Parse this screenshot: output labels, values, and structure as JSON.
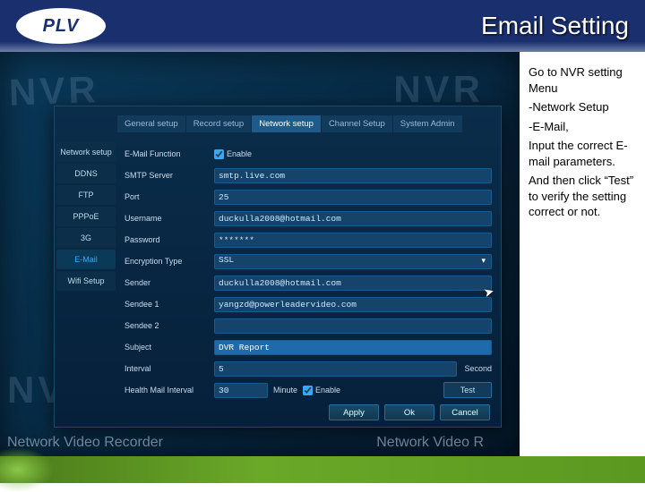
{
  "header": {
    "logo": "PLV",
    "title": "Email Setting"
  },
  "tabs": [
    {
      "label": "General setup"
    },
    {
      "label": "Record setup"
    },
    {
      "label": "Network setup",
      "active": true
    },
    {
      "label": "Channel Setup"
    },
    {
      "label": "System Admin"
    }
  ],
  "sidebar": [
    {
      "label": "Network setup"
    },
    {
      "label": "DDNS"
    },
    {
      "label": "FTP"
    },
    {
      "label": "PPPoE"
    },
    {
      "label": "3G"
    },
    {
      "label": "E-Mail",
      "active": true
    },
    {
      "label": "Wifi Setup"
    }
  ],
  "form": {
    "email_function": {
      "label": "E-Mail Function",
      "enable_label": "Enable",
      "checked": true
    },
    "smtp": {
      "label": "SMTP Server",
      "value": "smtp.live.com"
    },
    "port": {
      "label": "Port",
      "value": "25"
    },
    "username": {
      "label": "Username",
      "value": "duckulla2008@hotmail.com"
    },
    "password": {
      "label": "Password",
      "value": "*******"
    },
    "encryption": {
      "label": "Encryption Type",
      "value": "SSL"
    },
    "sender": {
      "label": "Sender",
      "value": "duckulla2008@hotmail.com"
    },
    "sendee1": {
      "label": "Sendee 1",
      "value": "yangzd@powerleadervideo.com"
    },
    "sendee2": {
      "label": "Sendee 2",
      "value": ""
    },
    "subject": {
      "label": "Subject",
      "value": "DVR Report"
    },
    "interval": {
      "label": "Interval",
      "value": "5",
      "unit": "Second"
    },
    "health": {
      "label": "Health Mail Interval",
      "value": "30",
      "unit": "Minute",
      "enable_label": "Enable",
      "checked": true,
      "test": "Test"
    }
  },
  "buttons": {
    "apply": "Apply",
    "ok": "Ok",
    "cancel": "Cancel"
  },
  "background": {
    "ghost": "NVR",
    "footer": "Network Video Recorder",
    "footer_r": "Network Video R"
  },
  "instructions": {
    "l1": "Go to NVR setting Menu",
    "l2": "-Network Setup",
    "l3": "-E-Mail,",
    "l4": "Input the correct E-mail parameters.",
    "l5": "And then click “Test” to verify the setting correct or not."
  }
}
